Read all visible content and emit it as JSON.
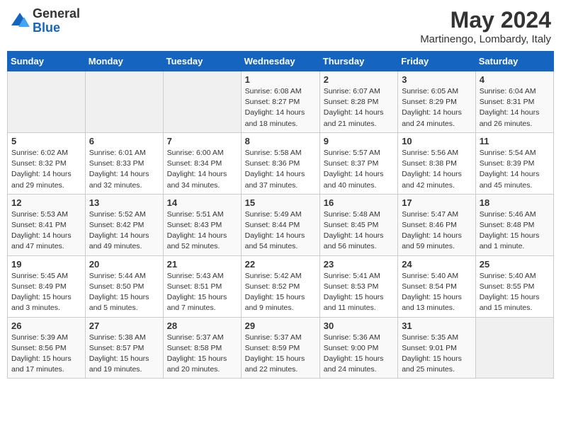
{
  "header": {
    "logo_general": "General",
    "logo_blue": "Blue",
    "month_title": "May 2024",
    "location": "Martinengo, Lombardy, Italy"
  },
  "weekdays": [
    "Sunday",
    "Monday",
    "Tuesday",
    "Wednesday",
    "Thursday",
    "Friday",
    "Saturday"
  ],
  "weeks": [
    [
      {
        "day": "",
        "info": ""
      },
      {
        "day": "",
        "info": ""
      },
      {
        "day": "",
        "info": ""
      },
      {
        "day": "1",
        "info": "Sunrise: 6:08 AM\nSunset: 8:27 PM\nDaylight: 14 hours and 18 minutes."
      },
      {
        "day": "2",
        "info": "Sunrise: 6:07 AM\nSunset: 8:28 PM\nDaylight: 14 hours and 21 minutes."
      },
      {
        "day": "3",
        "info": "Sunrise: 6:05 AM\nSunset: 8:29 PM\nDaylight: 14 hours and 24 minutes."
      },
      {
        "day": "4",
        "info": "Sunrise: 6:04 AM\nSunset: 8:31 PM\nDaylight: 14 hours and 26 minutes."
      }
    ],
    [
      {
        "day": "5",
        "info": "Sunrise: 6:02 AM\nSunset: 8:32 PM\nDaylight: 14 hours and 29 minutes."
      },
      {
        "day": "6",
        "info": "Sunrise: 6:01 AM\nSunset: 8:33 PM\nDaylight: 14 hours and 32 minutes."
      },
      {
        "day": "7",
        "info": "Sunrise: 6:00 AM\nSunset: 8:34 PM\nDaylight: 14 hours and 34 minutes."
      },
      {
        "day": "8",
        "info": "Sunrise: 5:58 AM\nSunset: 8:36 PM\nDaylight: 14 hours and 37 minutes."
      },
      {
        "day": "9",
        "info": "Sunrise: 5:57 AM\nSunset: 8:37 PM\nDaylight: 14 hours and 40 minutes."
      },
      {
        "day": "10",
        "info": "Sunrise: 5:56 AM\nSunset: 8:38 PM\nDaylight: 14 hours and 42 minutes."
      },
      {
        "day": "11",
        "info": "Sunrise: 5:54 AM\nSunset: 8:39 PM\nDaylight: 14 hours and 45 minutes."
      }
    ],
    [
      {
        "day": "12",
        "info": "Sunrise: 5:53 AM\nSunset: 8:41 PM\nDaylight: 14 hours and 47 minutes."
      },
      {
        "day": "13",
        "info": "Sunrise: 5:52 AM\nSunset: 8:42 PM\nDaylight: 14 hours and 49 minutes."
      },
      {
        "day": "14",
        "info": "Sunrise: 5:51 AM\nSunset: 8:43 PM\nDaylight: 14 hours and 52 minutes."
      },
      {
        "day": "15",
        "info": "Sunrise: 5:49 AM\nSunset: 8:44 PM\nDaylight: 14 hours and 54 minutes."
      },
      {
        "day": "16",
        "info": "Sunrise: 5:48 AM\nSunset: 8:45 PM\nDaylight: 14 hours and 56 minutes."
      },
      {
        "day": "17",
        "info": "Sunrise: 5:47 AM\nSunset: 8:46 PM\nDaylight: 14 hours and 59 minutes."
      },
      {
        "day": "18",
        "info": "Sunrise: 5:46 AM\nSunset: 8:48 PM\nDaylight: 15 hours and 1 minute."
      }
    ],
    [
      {
        "day": "19",
        "info": "Sunrise: 5:45 AM\nSunset: 8:49 PM\nDaylight: 15 hours and 3 minutes."
      },
      {
        "day": "20",
        "info": "Sunrise: 5:44 AM\nSunset: 8:50 PM\nDaylight: 15 hours and 5 minutes."
      },
      {
        "day": "21",
        "info": "Sunrise: 5:43 AM\nSunset: 8:51 PM\nDaylight: 15 hours and 7 minutes."
      },
      {
        "day": "22",
        "info": "Sunrise: 5:42 AM\nSunset: 8:52 PM\nDaylight: 15 hours and 9 minutes."
      },
      {
        "day": "23",
        "info": "Sunrise: 5:41 AM\nSunset: 8:53 PM\nDaylight: 15 hours and 11 minutes."
      },
      {
        "day": "24",
        "info": "Sunrise: 5:40 AM\nSunset: 8:54 PM\nDaylight: 15 hours and 13 minutes."
      },
      {
        "day": "25",
        "info": "Sunrise: 5:40 AM\nSunset: 8:55 PM\nDaylight: 15 hours and 15 minutes."
      }
    ],
    [
      {
        "day": "26",
        "info": "Sunrise: 5:39 AM\nSunset: 8:56 PM\nDaylight: 15 hours and 17 minutes."
      },
      {
        "day": "27",
        "info": "Sunrise: 5:38 AM\nSunset: 8:57 PM\nDaylight: 15 hours and 19 minutes."
      },
      {
        "day": "28",
        "info": "Sunrise: 5:37 AM\nSunset: 8:58 PM\nDaylight: 15 hours and 20 minutes."
      },
      {
        "day": "29",
        "info": "Sunrise: 5:37 AM\nSunset: 8:59 PM\nDaylight: 15 hours and 22 minutes."
      },
      {
        "day": "30",
        "info": "Sunrise: 5:36 AM\nSunset: 9:00 PM\nDaylight: 15 hours and 24 minutes."
      },
      {
        "day": "31",
        "info": "Sunrise: 5:35 AM\nSunset: 9:01 PM\nDaylight: 15 hours and 25 minutes."
      },
      {
        "day": "",
        "info": ""
      }
    ]
  ]
}
